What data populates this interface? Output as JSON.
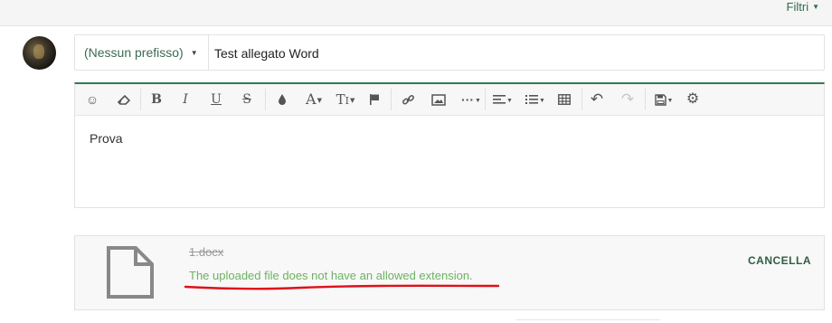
{
  "header": {
    "filter_label": "Filtri"
  },
  "compose": {
    "prefix_value": "(Nessun prefisso)",
    "subject_value": "Test allegato Word",
    "body_text": "Prova"
  },
  "toolbar": {
    "groups": [
      [
        "emoji-icon",
        "eraser-icon"
      ],
      [
        "bold-icon",
        "italic-icon",
        "underline-icon",
        "strikethrough-icon"
      ],
      [
        "color-drop-icon",
        "font-size-icon",
        "text-height-icon",
        "flag-icon"
      ],
      [
        "link-icon",
        "image-icon",
        "more-icon"
      ],
      [
        "align-icon",
        "list-icon",
        "table-icon"
      ],
      [
        "undo-icon",
        "redo-icon"
      ],
      [
        "save-icon",
        "settings-icon"
      ]
    ]
  },
  "attachment": {
    "filename": "1.docx",
    "error": "The uploaded file does not have an allowed extension.",
    "cancel_label": "CANCELLA"
  },
  "colors": {
    "accent_green": "#2e7d4f",
    "error_green": "#6cb25f",
    "annotation_red": "#e0101a"
  }
}
